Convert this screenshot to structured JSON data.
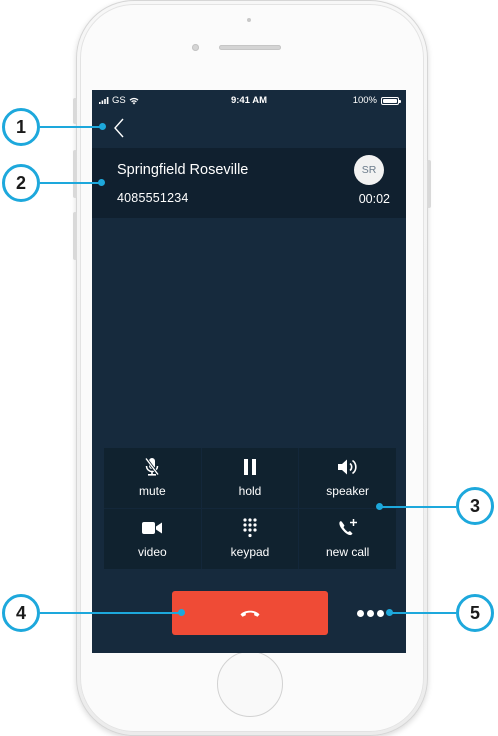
{
  "status_bar": {
    "carrier": "GS",
    "time": "9:41 AM",
    "battery": "100%"
  },
  "call": {
    "caller_name": "Springfield Roseville",
    "caller_number": "4085551234",
    "avatar_initials": "SR",
    "duration": "00:02"
  },
  "controls": [
    {
      "label": "mute",
      "icon": "microphone-off-icon"
    },
    {
      "label": "hold",
      "icon": "pause-icon"
    },
    {
      "label": "speaker",
      "icon": "speaker-icon"
    },
    {
      "label": "video",
      "icon": "video-camera-icon"
    },
    {
      "label": "keypad",
      "icon": "keypad-icon"
    },
    {
      "label": "new call",
      "icon": "add-call-icon"
    }
  ],
  "end_call": {
    "icon": "hang-up-icon",
    "color": "#ef4b36"
  },
  "more": {
    "icon": "more-dots-icon"
  },
  "callouts": [
    "1",
    "2",
    "3",
    "4",
    "5"
  ],
  "colors": {
    "screen_bg": "#162a3d",
    "card_bg": "#10202f",
    "accent": "#1da8dc",
    "end_call": "#ef4b36"
  }
}
